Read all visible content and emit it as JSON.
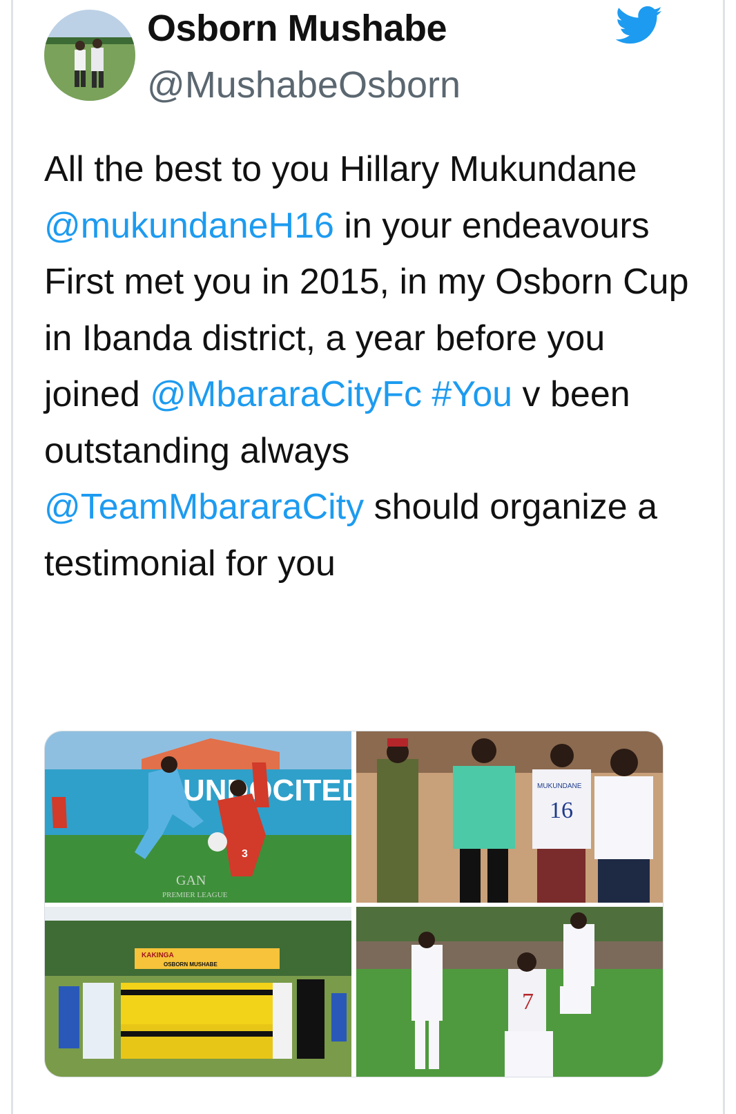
{
  "author": {
    "name": "Osborn Mushabe",
    "handle": "@MushabeOsborn"
  },
  "logo": "twitter-bird-icon",
  "tweet": {
    "segments": [
      {
        "type": "text",
        "text": "All the best to you Hillary Mukundane "
      },
      {
        "type": "mention",
        "text": "@mukundaneH16"
      },
      {
        "type": "text",
        "text": " in your endeavours"
      },
      {
        "type": "break"
      },
      {
        "type": "text",
        "text": "First met you in 2015, in my Osborn Cup in Ibanda district, a year before you joined "
      },
      {
        "type": "mention",
        "text": "@MbararaCityFc"
      },
      {
        "type": "text",
        "text": " "
      },
      {
        "type": "hashtag",
        "text": "#You"
      },
      {
        "type": "text",
        "text": " v been outstanding always"
      },
      {
        "type": "break"
      },
      {
        "type": "mention",
        "text": "@TeamMbararaCity"
      },
      {
        "type": "text",
        "text": " should organize a testimonial for you"
      }
    ]
  },
  "media": {
    "photo1": {
      "banner_text": "UNDOCITED",
      "watermark": "GAN",
      "watermark2": "PREMIER LEAGUE",
      "jersey_number": "3"
    },
    "photo2": {
      "shirt_name": "MUKUNDANE",
      "shirt_number": "16"
    },
    "photo3": {
      "banner_line1": "KAKINGA",
      "banner_line2": "OSBORN MUSHABE"
    },
    "photo4": {
      "jersey_number": "7"
    }
  },
  "colors": {
    "link": "#1d9bf0",
    "handle": "#5b6770",
    "twitter_blue": "#1d9bf0"
  }
}
